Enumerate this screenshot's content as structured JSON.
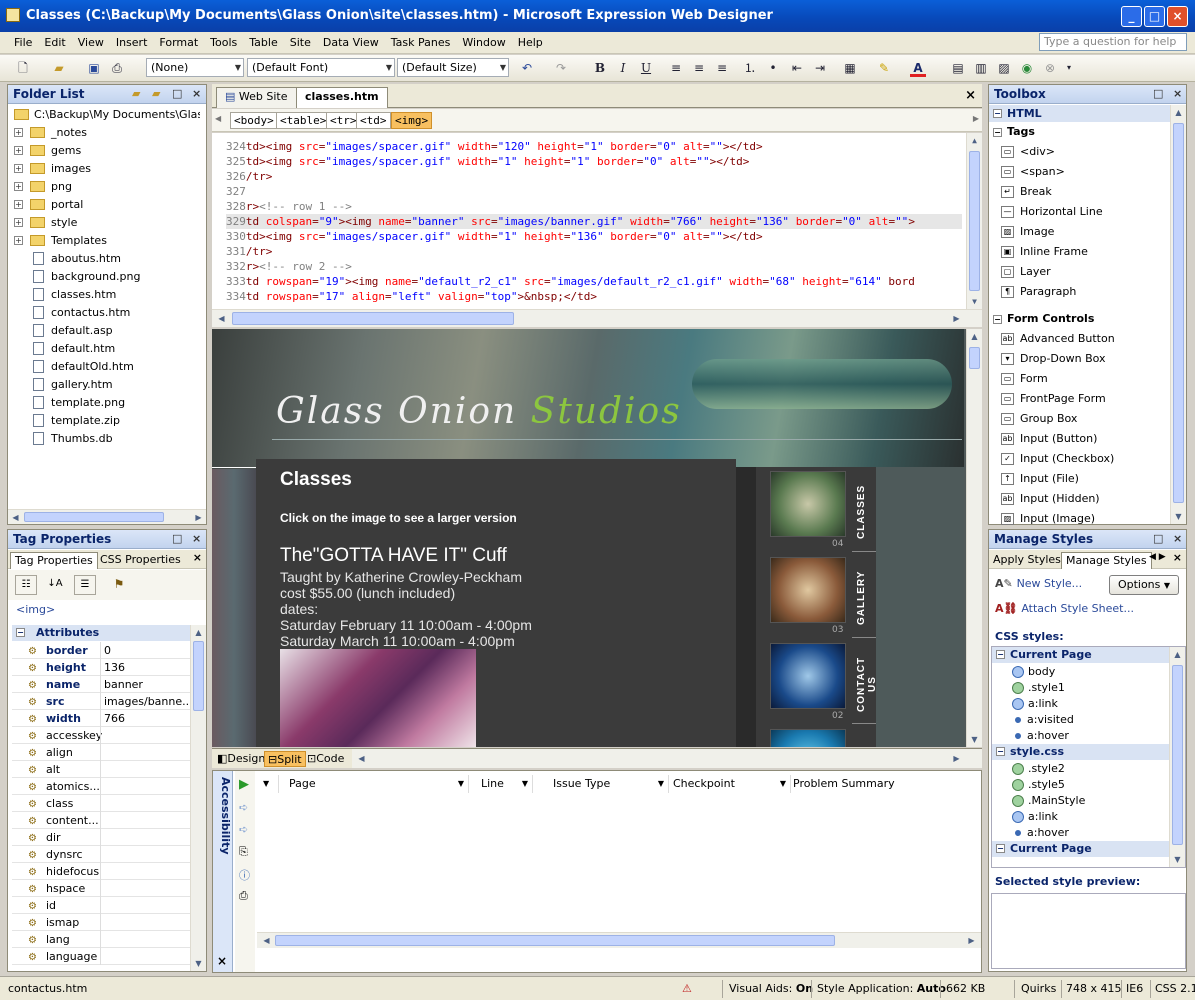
{
  "window": {
    "title": "Classes (C:\\Backup\\My Documents\\Glass Onion\\site\\classes.htm) - Microsoft Expression Web Designer"
  },
  "menu": [
    "File",
    "Edit",
    "View",
    "Insert",
    "Format",
    "Tools",
    "Table",
    "Site",
    "Data View",
    "Task Panes",
    "Window",
    "Help"
  ],
  "menu_help_placeholder": "Type a question for help",
  "toolbar": {
    "style": "(None)",
    "font": "(Default Font)",
    "size": "(Default Size)",
    "bold": "B",
    "italic": "I",
    "underline": "U"
  },
  "folder_list": {
    "title": "Folder List",
    "root": "C:\\Backup\\My Documents\\Glass Onion",
    "folders": [
      "_notes",
      "gems",
      "images",
      "png",
      "portal",
      "style",
      "Templates"
    ],
    "files": [
      "aboutus.htm",
      "background.png",
      "classes.htm",
      "contactus.htm",
      "default.asp",
      "default.htm",
      "defaultOld.htm",
      "gallery.htm",
      "template.png",
      "template.zip",
      "Thumbs.db"
    ]
  },
  "tag_properties": {
    "title": "Tag Properties",
    "tabs": [
      "Tag Properties",
      "CSS Properties"
    ],
    "tag": "<img>",
    "section": "Attributes",
    "set_attrs": [
      {
        "name": "border",
        "value": "0"
      },
      {
        "name": "height",
        "value": "136"
      },
      {
        "name": "name",
        "value": "banner"
      },
      {
        "name": "src",
        "value": "images/banne..."
      },
      {
        "name": "width",
        "value": "766"
      }
    ],
    "other_attrs": [
      "accesskey",
      "align",
      "alt",
      "atomics...",
      "class",
      "content...",
      "dir",
      "dynsrc",
      "hidefocus",
      "hspace",
      "id",
      "ismap",
      "lang",
      "language"
    ]
  },
  "editor": {
    "tabs": [
      "Web Site",
      "classes.htm"
    ],
    "quick_tags": [
      "<body>",
      "<table>",
      "<tr>",
      "<td>",
      "<img>"
    ],
    "code_lines": [
      {
        "n": "324",
        "html": "td><img src=\"images/spacer.gif\" width=\"120\" height=\"1\" border=\"0\" alt=\"\"></td>"
      },
      {
        "n": "325",
        "html": "td><img src=\"images/spacer.gif\" width=\"1\" height=\"1\" border=\"0\" alt=\"\"></td>"
      },
      {
        "n": "326",
        "html": "/tr>"
      },
      {
        "n": "327",
        "html": ""
      },
      {
        "n": "328",
        "html": "r><!-- row 1 -->"
      },
      {
        "n": "329",
        "html": "td colspan=\"9\"><img name=\"banner\" src=\"images/banner.gif\" width=\"766\" height=\"136\" border=\"0\" alt=\"\">"
      },
      {
        "n": "330",
        "html": "td><img src=\"images/spacer.gif\" width=\"1\" height=\"136\" border=\"0\" alt=\"\"></td>"
      },
      {
        "n": "331",
        "html": "/tr>"
      },
      {
        "n": "332",
        "html": "r><!-- row 2 -->"
      },
      {
        "n": "333",
        "html": "td rowspan=\"19\"><img name=\"default_r2_c1\" src=\"images/default_r2_c1.gif\" width=\"68\" height=\"614\" bord"
      },
      {
        "n": "334",
        "html": "td rowspan=\"17\" align=\"left\" valign=\"top\">&nbsp;</td>"
      }
    ],
    "view_modes": [
      "Design",
      "Split",
      "Code"
    ]
  },
  "design": {
    "banner_text_1": "Glass Onion",
    "banner_text_2": "Studios",
    "heading": "Classes",
    "subheading": "Click on the image to see a larger version",
    "class_title": "The\"GOTTA HAVE IT\" Cuff",
    "lines": [
      "Taught by Katherine Crowley-Peckham",
      "cost $55.00 (lunch included)",
      "dates:",
      "Saturday February 11 10:00am - 4:00pm",
      "Saturday March 11 10:00am - 4:00pm"
    ],
    "nav": [
      {
        "label": "CLASSES",
        "num": "04"
      },
      {
        "label": "GALLERY",
        "num": "03"
      },
      {
        "label": "CONTACT US",
        "num": "02"
      },
      {
        "label": "US",
        "num": ""
      }
    ]
  },
  "accessibility": {
    "title": "Accessibility",
    "columns": [
      "Page",
      "Line",
      "Issue Type",
      "Checkpoint",
      "Problem Summary"
    ]
  },
  "toolbox": {
    "title": "Toolbox",
    "section": "HTML",
    "tags_group": "Tags",
    "tags": [
      "<div>",
      "<span>",
      "Break",
      "Horizontal Line",
      "Image",
      "Inline Frame",
      "Layer",
      "Paragraph"
    ],
    "form_group": "Form Controls",
    "forms": [
      "Advanced Button",
      "Drop-Down Box",
      "Form",
      "FrontPage Form",
      "Group Box",
      "Input (Button)",
      "Input (Checkbox)",
      "Input (File)",
      "Input (Hidden)",
      "Input (Image)"
    ]
  },
  "manage_styles": {
    "title": "Manage Styles",
    "tabs": [
      "Apply Styles",
      "Manage Styles"
    ],
    "new_style": "New Style...",
    "attach": "Attach Style Sheet...",
    "options": "Options",
    "css_label": "CSS styles:",
    "groups": [
      {
        "name": "Current Page",
        "items": [
          "body",
          ".style1",
          "a:link",
          "a:visited",
          "a:hover"
        ]
      },
      {
        "name": "style.css",
        "items": [
          ".style2",
          ".style5",
          ".MainStyle",
          "a:link",
          "a:hover"
        ]
      },
      {
        "name": "Current Page",
        "items": []
      }
    ],
    "preview_label": "Selected style preview:"
  },
  "statusbar": {
    "file": "contactus.htm",
    "visual_aids_label": "Visual Aids:",
    "visual_aids_value": "On",
    "style_app_label": "Style Application:",
    "style_app_value": "Auto",
    "size": "662 KB",
    "mode": "Quirks",
    "dims": "748 x 415",
    "browser": "IE6",
    "css": "CSS 2.1"
  },
  "colors": {
    "accent": "#0a246a",
    "titlebar": "#0a5fd8",
    "selected_tag": "#f8c060",
    "studios_green": "#8cc63f"
  }
}
